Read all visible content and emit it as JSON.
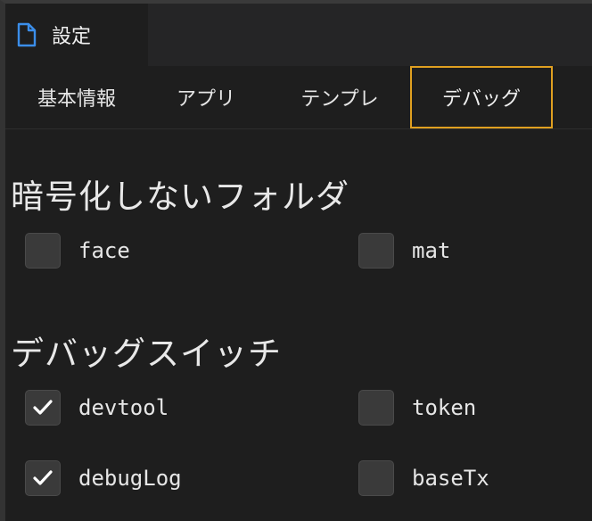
{
  "window": {
    "title": "設定",
    "title_icon": "file-icon"
  },
  "tabs": [
    {
      "label": "基本情報",
      "active": false
    },
    {
      "label": "アプリ",
      "active": false
    },
    {
      "label": "テンプレ",
      "active": false
    },
    {
      "label": "デバッグ",
      "active": true
    }
  ],
  "sections": {
    "no_encrypt": {
      "title": "暗号化しないフォルダ",
      "items": [
        {
          "label": "face",
          "checked": false
        },
        {
          "label": "mat",
          "checked": false
        }
      ]
    },
    "debug_switch": {
      "title": "デバッグスイッチ",
      "items": [
        {
          "label": "devtool",
          "checked": true
        },
        {
          "label": "token",
          "checked": false
        },
        {
          "label": "debugLog",
          "checked": true
        },
        {
          "label": "baseTx",
          "checked": false
        }
      ]
    }
  },
  "colors": {
    "active_tab_border": "#e0a020",
    "file_icon": "#3b8eea",
    "checkbox_bg": "#3a3a3a"
  }
}
